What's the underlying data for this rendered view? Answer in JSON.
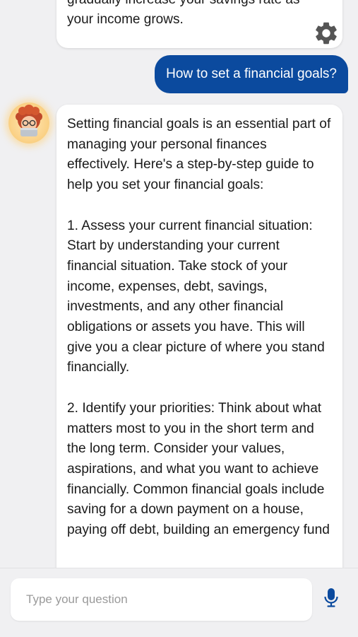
{
  "previous_message": {
    "line1": "gradually increase your savings rate as",
    "line2": "your income grows."
  },
  "user_message": "How to set a financial goals?",
  "bot_message": {
    "paragraphs": [
      "Setting financial goals is an essential part of managing your personal finances effectively. Here's a step-by-step guide to help you set your financial goals:",
      "1. Assess your current financial situation: Start by understanding your current financial situation. Take stock of your income, expenses, debt, savings, investments, and any other financial obligations or assets you have. This will give you a clear picture of where you stand financially.",
      "2. Identify your priorities: Think about what matters most to you in the short term and the long term. Consider your values, aspirations, and what you want to achieve financially. Common financial goals include saving for a down payment on a house, paying off debt, building an emergency fund"
    ]
  },
  "input": {
    "placeholder": "Type your question"
  },
  "icons": {
    "settings": "gear-icon",
    "voice": "microphone-icon",
    "avatar": "bot-avatar"
  },
  "colors": {
    "user_bubble": "#0b4a9e",
    "mic": "#0b4a9e",
    "background": "#f0f0f2"
  }
}
